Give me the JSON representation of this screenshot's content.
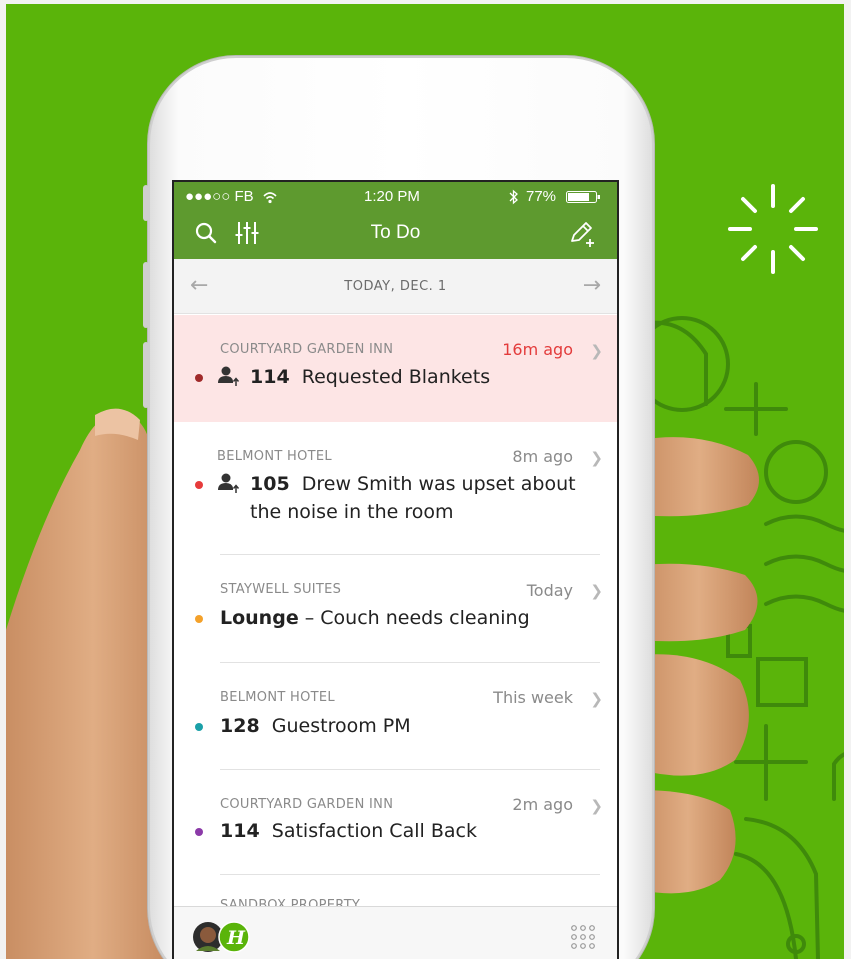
{
  "status_bar": {
    "carrier": "●●●○○ FB",
    "time": "1:20 PM",
    "battery": "77%"
  },
  "nav": {
    "title": "To Do"
  },
  "date_bar": {
    "date": "TODAY, DEC. 1"
  },
  "tasks": [
    {
      "property": "COURTYARD GARDEN INN",
      "time": "16m ago",
      "room": "114",
      "text": "Requested Blankets",
      "dot_color": "#a02a2a",
      "has_guest_icon": true,
      "urgent": true
    },
    {
      "property": "BELMONT HOTEL",
      "time": "8m ago",
      "room": "105",
      "text_line1": "Drew Smith was upset about",
      "text_line2": "the noise in the room",
      "dot_color": "#e63b3b",
      "has_guest_icon": true
    },
    {
      "property": "STAYWELL SUITES",
      "time": "Today",
      "room": "Lounge",
      "text": "– Couch needs cleaning",
      "dot_color": "#f4a12a"
    },
    {
      "property": "BELMONT HOTEL",
      "time": "This week",
      "room": "128",
      "text": "Guestroom PM",
      "dot_color": "#1aa0a8"
    },
    {
      "property": "COURTYARD GARDEN INN",
      "time": "2m ago",
      "room": "114",
      "text": "Satisfaction Call Back",
      "dot_color": "#8b3aa8"
    }
  ],
  "peek_item": {
    "property": "SANDBOX PROPERTY"
  },
  "colors": {
    "background_green": "#5ab40a",
    "nav_green": "#5e9a2f",
    "urgent_row": "#fde5e5",
    "urgent_time": "#e33b3b"
  },
  "icons": [
    "search-icon",
    "filter-sliders-icon",
    "compose-icon",
    "bluetooth-icon",
    "wifi-icon",
    "battery-icon",
    "back-arrow-icon",
    "forward-arrow-icon",
    "chevron-right-icon",
    "guest-icon",
    "avatar",
    "hotel-logo",
    "grid-menu-icon"
  ]
}
